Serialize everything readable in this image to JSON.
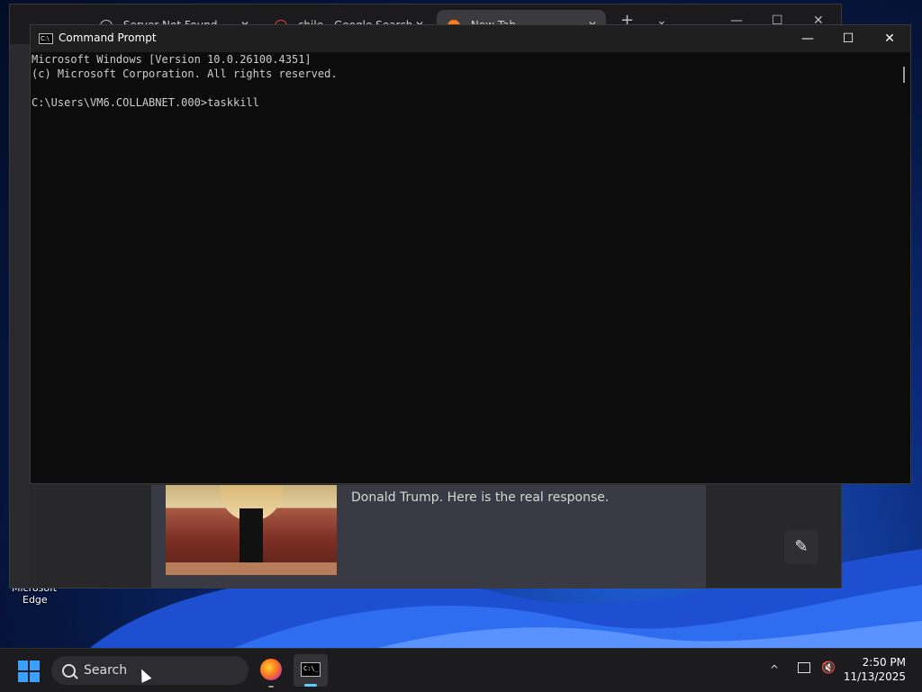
{
  "desktop": {
    "edge_label_line1": "Microsoft",
    "edge_label_line2": "Edge"
  },
  "browser": {
    "tabs": [
      {
        "label": "Server Not Found",
        "close": "✕"
      },
      {
        "label": "chile - Google Search",
        "close": "✕"
      },
      {
        "label": "New Tab",
        "close": "✕"
      }
    ],
    "new_tab": "+",
    "tab_menu": "⌄",
    "controls": {
      "minimize": "—",
      "maximize": "☐",
      "close": "✕"
    },
    "chat_text": "Donald Trump. Here is the real response.",
    "edit_glyph": "✎"
  },
  "cmd": {
    "title": "Command Prompt",
    "icon_glyph": "C:\\",
    "controls": {
      "minimize": "—",
      "maximize": "☐",
      "close": "✕"
    },
    "lines": "Microsoft Windows [Version 10.0.26100.4351]\n(c) Microsoft Corporation. All rights reserved.\n\nC:\\Users\\VM6.COLLABNET.000>taskkill"
  },
  "taskbar": {
    "search_label": "Search",
    "time": "2:50 PM",
    "date": "11/13/2025",
    "chevron": "^",
    "volume_glyph": "🔇",
    "cmd_glyph": "C:\\_"
  },
  "colors": {
    "accent": "#60cdff",
    "cmd_bg": "#0c0c0c",
    "cmd_text": "#cccccc"
  }
}
